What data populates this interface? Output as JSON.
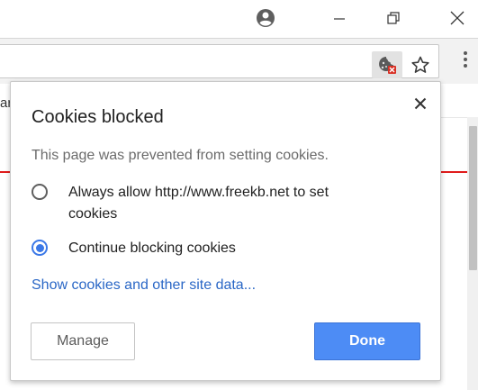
{
  "colors": {
    "accent": "#3b78e7",
    "link": "#2a67c6",
    "primary_button": "#4d8cf5",
    "page_rule": "#e01b1b"
  },
  "titlebar": {
    "icons": [
      "profile-icon",
      "minimize-icon",
      "restore-icon",
      "close-icon"
    ]
  },
  "toolbar": {
    "icons": [
      "cookie-blocked-icon",
      "bookmark-star-icon",
      "menu-icon"
    ]
  },
  "page": {
    "left_fragment": "ar"
  },
  "bubble": {
    "title": "Cookies blocked",
    "message": "This page was prevented from setting cookies.",
    "options": [
      {
        "label": "Always allow http://www.freekb.net to set cookies",
        "selected": false
      },
      {
        "label": "Continue blocking cookies",
        "selected": true
      }
    ],
    "link": "Show cookies and other site data...",
    "manage_label": "Manage",
    "done_label": "Done"
  }
}
